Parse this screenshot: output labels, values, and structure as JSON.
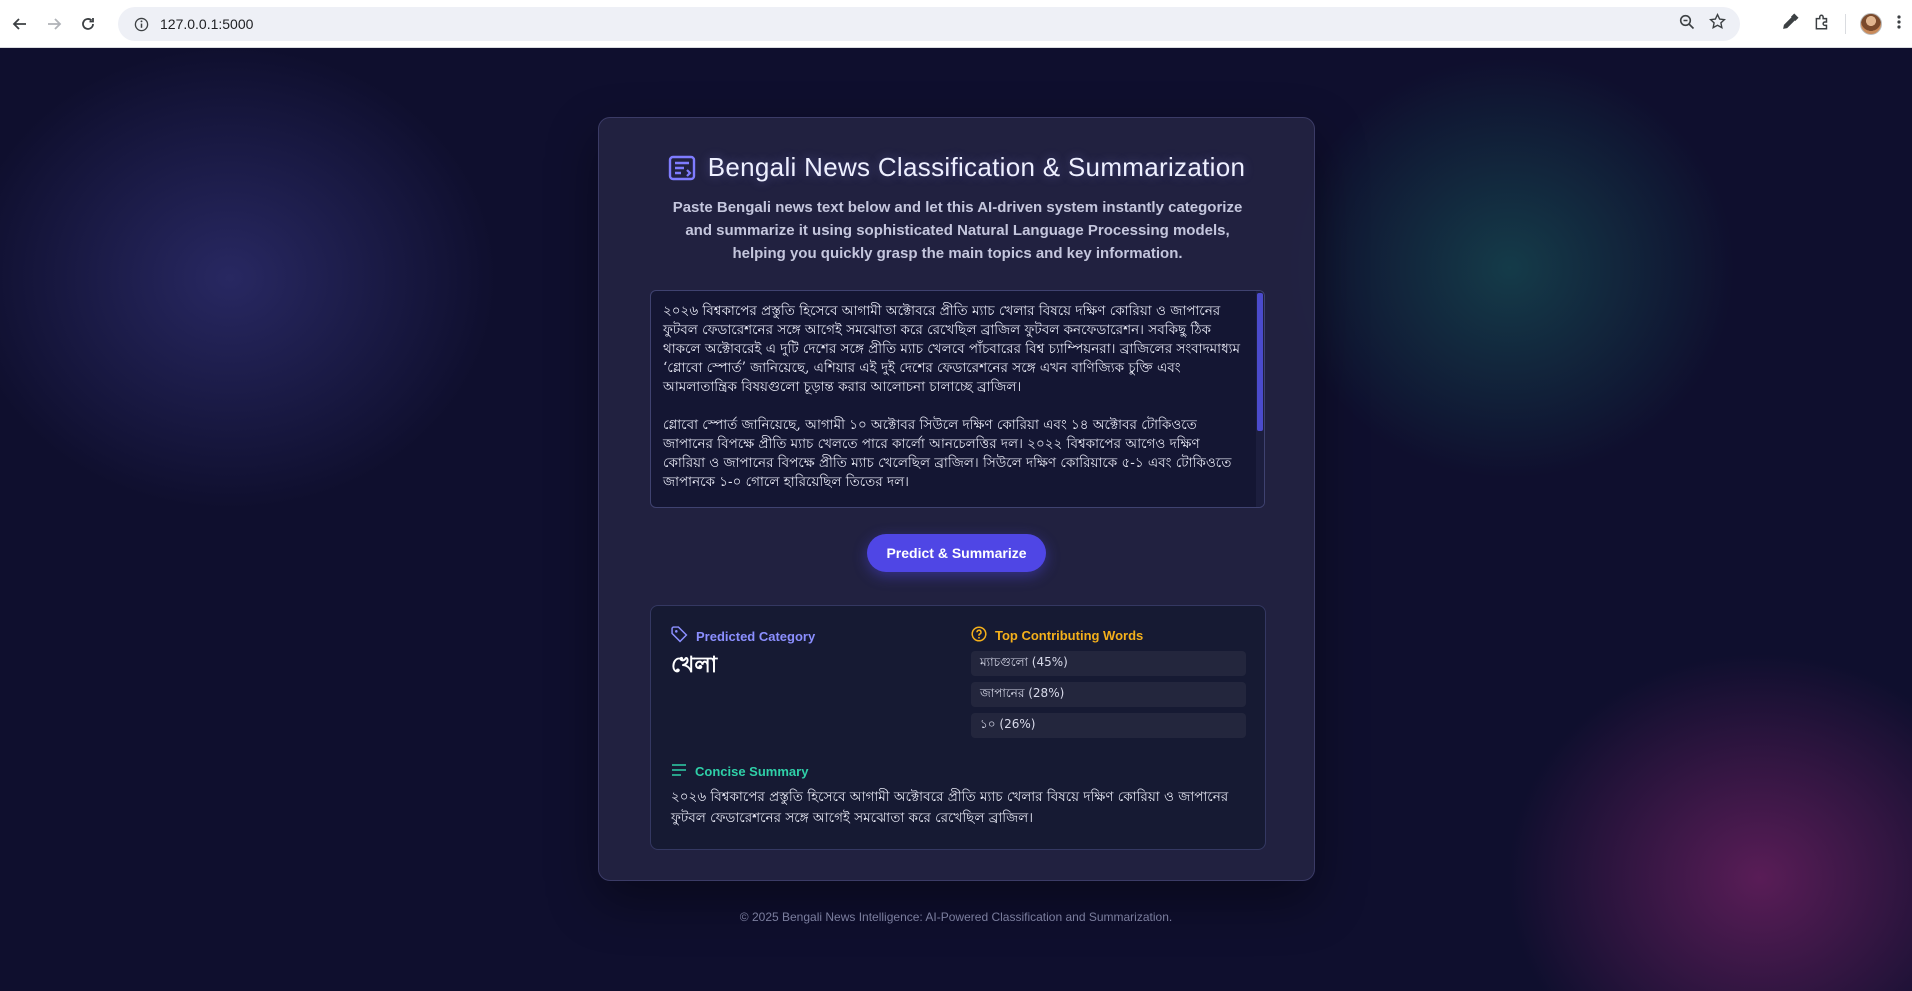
{
  "browser": {
    "url": "127.0.0.1:5000"
  },
  "app": {
    "title": "Bengali News Classification & Summarization",
    "subtitle": "Paste Bengali news text below and let this AI-driven system instantly categorize and summarize it using sophisticated Natural Language Processing models, helping you quickly grasp the main topics and key information.",
    "news_text": "২০২৬ বিশ্বকাপের প্রস্তুতি হিসেবে আগামী অক্টোবরে প্রীতি ম্যাচ খেলার বিষয়ে দক্ষিণ কোরিয়া ও জাপানের ফুটবল ফেডারেশনের সঙ্গে আগেই সমঝোতা করে রেখেছিল ব্রাজিল ফুটবল কনফেডারেশন। সবকিছু ঠিক থাকলে অক্টোবরেই এ দুটি দেশের সঙ্গে প্রীতি ম্যাচ খেলবে পাঁচবারের বিশ্ব চ্যাম্পিয়নরা। ব্রাজিলের সংবাদমাধ্যম ‘গ্লোবো স্পোর্ত’ জানিয়েছে, এশিয়ার এই দুই দেশের ফেডারেশনের সঙ্গে এখন বাণিজ্যিক চুক্তি এবং আমলাতান্ত্রিক বিষয়গুলো চূড়ান্ত করার আলোচনা চালাচ্ছে ব্রাজিল।\n\nগ্লোবো স্পোর্ত জানিয়েছে, আগামী ১০ অক্টোবর সিউলে দক্ষিণ কোরিয়া এবং ১৪ অক্টোবর টোকিওতে জাপানের বিপক্ষে প্রীতি ম্যাচ খেলতে পারে কার্লো আনচেলত্তির দল। ২০২২ বিশ্বকাপের আগেও দক্ষিণ কোরিয়া ও জাপানের বিপক্ষে প্রীতি ম্যাচ খেলেছিল ব্রাজিল। সিউলে দক্ষিণ কোরিয়াকে ৫-১ এবং টোকিওতে জাপানকে ১-০ গোলে হারিয়েছিল তিতের দল।",
    "predict_button": "Predict & Summarize",
    "result": {
      "predicted_category_label": "Predicted Category",
      "predicted_category": "খেলা",
      "top_words_label": "Top Contributing Words",
      "top_words": [
        {
          "text": "ম্যাচগুলো (45%)"
        },
        {
          "text": "জাপানের (28%)"
        },
        {
          "text": "১০ (26%)"
        }
      ],
      "summary_label": "Concise Summary",
      "summary": "২০২৬ বিশ্বকাপের প্রস্তুতি হিসেবে আগামী অক্টোবরে প্রীতি ম্যাচ খেলার বিষয়ে দক্ষিণ কোরিয়া ও জাপানের ফুটবল ফেডারেশনের সঙ্গে আগেই সমঝোতা করে রেখেছিল ব্রাজিল।"
    },
    "footer": "© 2025 Bengali News Intelligence: AI-Powered Classification and Summarization."
  },
  "colors": {
    "accent": "#4f46e5",
    "category_heading": "#8b8fff",
    "words_heading": "#f4b01b",
    "summary_heading": "#2fd0a8"
  },
  "icons": {
    "title": "news-article-icon",
    "category": "tag-icon",
    "words": "question-circle-icon",
    "summary": "lines-icon"
  }
}
